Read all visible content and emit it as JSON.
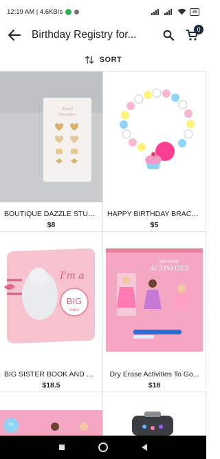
{
  "status_bar": {
    "time_speed": "12:19 AM | 4.6KB/s",
    "battery": "38"
  },
  "header": {
    "title": "Birthday Registry for...",
    "cart_count": "0"
  },
  "sort": {
    "label": "SORT"
  },
  "products": [
    {
      "title": "BOUTIQUE DAZZLE STUD...",
      "price": "$8"
    },
    {
      "title": "HAPPY BIRTHDAY BRACEL...",
      "price": "$5"
    },
    {
      "title": "BIG SISTER BOOK AND PL...",
      "price": "$18.5"
    },
    {
      "title": "Dry Erase Activities To Go...",
      "price": "$18"
    }
  ],
  "colors": {
    "accent": "#1b2d40",
    "divider": "#e2e2e2",
    "pink": "#f4a6c3"
  }
}
